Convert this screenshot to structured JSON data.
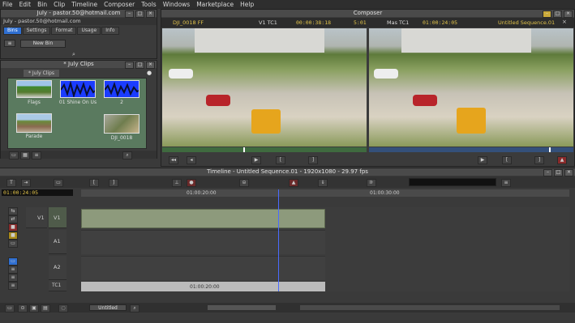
{
  "menu": [
    "File",
    "Edit",
    "Bin",
    "Clip",
    "Timeline",
    "Composer",
    "Tools",
    "Windows",
    "Marketplace",
    "Help"
  ],
  "project": {
    "title": "July - pastor.50@hotmail.com",
    "subtitle": "July - pastor.50@hotmail.com",
    "tabs": [
      "Bins",
      "Settings",
      "Format",
      "Usage",
      "Info"
    ],
    "new_bin": "New Bin"
  },
  "bin": {
    "title": "* July Clips",
    "tab": "* July Clips",
    "clips": [
      {
        "name": "Flags"
      },
      {
        "name": "01 Shine On Us"
      },
      {
        "name": "2"
      },
      {
        "name": "Parade"
      },
      {
        "name": "DJI_0018"
      }
    ]
  },
  "composer": {
    "title": "Composer",
    "source_clip": "DJI_0018 FF",
    "tc_label": "V1 TC1",
    "source_tc": "00:00:38:18",
    "duration": "5:01",
    "mas_label": "Mas TC1",
    "record_tc": "01:00:24:05",
    "sequence": "Untitled Sequence.01"
  },
  "timeline": {
    "title": "Timeline - Untitled Sequence.01 - 1920x1080 - 29.97 fps",
    "current_tc": "01:00:24:05",
    "ruler": [
      "01:00:20:00",
      "01:00:30:00"
    ],
    "tracks": [
      "V1",
      "A1",
      "A2",
      "TC1"
    ],
    "track_patch": "V1",
    "tc_track_label": "01:00:20:00",
    "bottom_select": "Untitled"
  },
  "colors": {
    "accent": "#2f6fd1",
    "playhead": "#4a6bff",
    "clip": "#8d9a7c",
    "audio_thumb": "#1b3cff"
  }
}
